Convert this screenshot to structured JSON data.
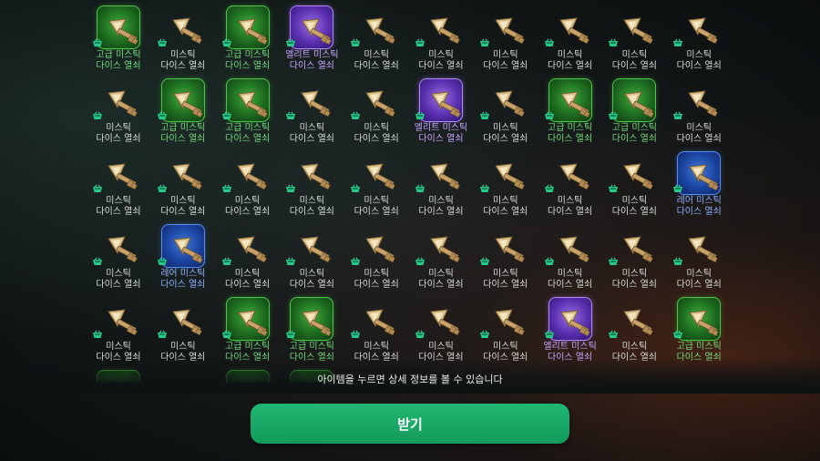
{
  "hint_text": "아이템을 누르면 상세 정보를 볼 수 있습니다",
  "receive_button_label": "받기",
  "colors": {
    "advanced": "#74dc7a",
    "rare": "#8fb0ff",
    "elite": "#c9a6ff",
    "common": "#d9dcd8",
    "button": "#1aa867",
    "cart_icon": "#27c98a"
  },
  "item_icon": "key-icon",
  "cart_icon": "shopping-basket-icon",
  "items": [
    {
      "tier": "advanced",
      "line1": "고급 미스틱",
      "line2": "다이스 열쇠"
    },
    {
      "tier": "common",
      "line1": "미스틱",
      "line2": "다이스 열쇠"
    },
    {
      "tier": "advanced",
      "line1": "고급 미스틱",
      "line2": "다이스 열쇠"
    },
    {
      "tier": "elite",
      "line1": "엘리트 미스틱",
      "line2": "다이스 열쇠"
    },
    {
      "tier": "common",
      "line1": "미스틱",
      "line2": "다이스 열쇠"
    },
    {
      "tier": "common",
      "line1": "미스틱",
      "line2": "다이스 열쇠"
    },
    {
      "tier": "common",
      "line1": "미스틱",
      "line2": "다이스 열쇠"
    },
    {
      "tier": "common",
      "line1": "미스틱",
      "line2": "다이스 열쇠"
    },
    {
      "tier": "common",
      "line1": "미스틱",
      "line2": "다이스 열쇠"
    },
    {
      "tier": "common",
      "line1": "미스틱",
      "line2": "다이스 열쇠"
    },
    {
      "tier": "common",
      "line1": "미스틱",
      "line2": "다이스 열쇠"
    },
    {
      "tier": "advanced",
      "line1": "고급 미스틱",
      "line2": "다이스 열쇠"
    },
    {
      "tier": "advanced",
      "line1": "고급 미스틱",
      "line2": "다이스 열쇠"
    },
    {
      "tier": "common",
      "line1": "미스틱",
      "line2": "다이스 열쇠"
    },
    {
      "tier": "common",
      "line1": "미스틱",
      "line2": "다이스 열쇠"
    },
    {
      "tier": "elite",
      "line1": "엘리트 미스틱",
      "line2": "다이스 열쇠"
    },
    {
      "tier": "common",
      "line1": "미스틱",
      "line2": "다이스 열쇠"
    },
    {
      "tier": "advanced",
      "line1": "고급 미스틱",
      "line2": "다이스 열쇠"
    },
    {
      "tier": "advanced",
      "line1": "고급 미스틱",
      "line2": "다이스 열쇠"
    },
    {
      "tier": "common",
      "line1": "미스틱",
      "line2": "다이스 열쇠"
    },
    {
      "tier": "common",
      "line1": "미스틱",
      "line2": "다이스 열쇠"
    },
    {
      "tier": "common",
      "line1": "미스틱",
      "line2": "다이스 열쇠"
    },
    {
      "tier": "common",
      "line1": "미스틱",
      "line2": "다이스 열쇠"
    },
    {
      "tier": "common",
      "line1": "미스틱",
      "line2": "다이스 열쇠"
    },
    {
      "tier": "common",
      "line1": "미스틱",
      "line2": "다이스 열쇠"
    },
    {
      "tier": "common",
      "line1": "미스틱",
      "line2": "다이스 열쇠"
    },
    {
      "tier": "common",
      "line1": "미스틱",
      "line2": "다이스 열쇠"
    },
    {
      "tier": "common",
      "line1": "미스틱",
      "line2": "다이스 열쇠"
    },
    {
      "tier": "common",
      "line1": "미스틱",
      "line2": "다이스 열쇠"
    },
    {
      "tier": "rare",
      "line1": "레어 미스틱",
      "line2": "다이스 열쇠"
    },
    {
      "tier": "common",
      "line1": "미스틱",
      "line2": "다이스 열쇠"
    },
    {
      "tier": "rare",
      "line1": "레어 미스틱",
      "line2": "다이스 열쇠"
    },
    {
      "tier": "common",
      "line1": "미스틱",
      "line2": "다이스 열쇠"
    },
    {
      "tier": "common",
      "line1": "미스틱",
      "line2": "다이스 열쇠"
    },
    {
      "tier": "common",
      "line1": "미스틱",
      "line2": "다이스 열쇠"
    },
    {
      "tier": "common",
      "line1": "미스틱",
      "line2": "다이스 열쇠"
    },
    {
      "tier": "common",
      "line1": "미스틱",
      "line2": "다이스 열쇠"
    },
    {
      "tier": "common",
      "line1": "미스틱",
      "line2": "다이스 열쇠"
    },
    {
      "tier": "common",
      "line1": "미스틱",
      "line2": "다이스 열쇠"
    },
    {
      "tier": "common",
      "line1": "미스틱",
      "line2": "다이스 열쇠"
    },
    {
      "tier": "common",
      "line1": "미스틱",
      "line2": "다이스 열쇠"
    },
    {
      "tier": "common",
      "line1": "미스틱",
      "line2": "다이스 열쇠"
    },
    {
      "tier": "advanced",
      "line1": "고급 미스틱",
      "line2": "다이스 열쇠"
    },
    {
      "tier": "advanced",
      "line1": "고급 미스틱",
      "line2": "다이스 열쇠"
    },
    {
      "tier": "common",
      "line1": "미스틱",
      "line2": "다이스 열쇠"
    },
    {
      "tier": "common",
      "line1": "미스틱",
      "line2": "다이스 열쇠"
    },
    {
      "tier": "common",
      "line1": "미스틱",
      "line2": "다이스 열쇠"
    },
    {
      "tier": "elite",
      "line1": "엘리트 미스틱",
      "line2": "다이스 열쇠"
    },
    {
      "tier": "common",
      "line1": "미스틱",
      "line2": "다이스 열쇠"
    },
    {
      "tier": "advanced",
      "line1": "고급 미스틱",
      "line2": "다이스 열쇠"
    }
  ],
  "partial_row_tiers": [
    "advanced",
    "common",
    "advanced",
    "advanced",
    "common",
    "common",
    "common",
    "common",
    "common",
    "common"
  ]
}
